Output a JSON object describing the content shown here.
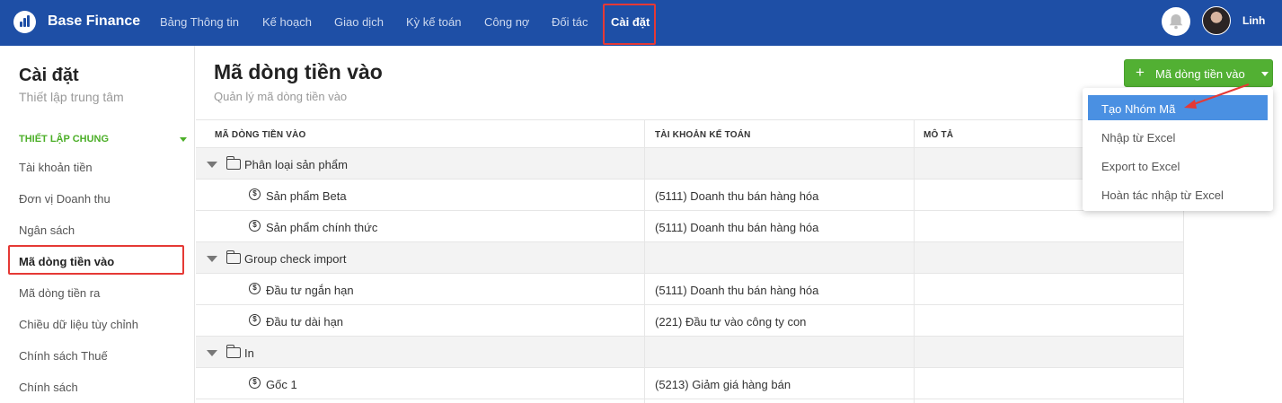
{
  "header": {
    "brand": "Base Finance",
    "nav": [
      {
        "label": "Bảng Thông tin"
      },
      {
        "label": "Kế hoạch"
      },
      {
        "label": "Giao dịch"
      },
      {
        "label": "Kỳ kế toán"
      },
      {
        "label": "Công nợ"
      },
      {
        "label": "Đối tác"
      },
      {
        "label": "Cài đặt",
        "active": true
      }
    ],
    "user_name": "Linh",
    "icons": [
      "bell-icon",
      "avatar"
    ]
  },
  "sidebar": {
    "title": "Cài đặt",
    "subtitle": "Thiết lập trung tâm",
    "section": "THIẾT LẬP CHUNG",
    "items": [
      {
        "label": "Tài khoản tiền"
      },
      {
        "label": "Đơn vị Doanh thu"
      },
      {
        "label": "Ngân sách"
      },
      {
        "label": "Mã dòng tiền vào",
        "active": true
      },
      {
        "label": "Mã dòng tiền ra"
      },
      {
        "label": "Chiều dữ liệu tùy chỉnh"
      },
      {
        "label": "Chính sách Thuế"
      },
      {
        "label": "Chính sách"
      }
    ]
  },
  "main": {
    "title": "Mã dòng tiền vào",
    "subtitle": "Quản lý mã dòng tiền vào",
    "primary_button": {
      "icon": "+",
      "label": "Mã dòng tiền vào"
    },
    "table": {
      "columns": [
        "MÃ DÒNG TIỀN VÀO",
        "TÀI KHOẢN KẾ TOÁN",
        "MÔ TẢ"
      ],
      "rows": [
        {
          "type": "group",
          "name": "Phân loại sản phẩm"
        },
        {
          "type": "item",
          "name": "Sản phẩm Beta",
          "account": "(5111) Doanh thu bán hàng hóa"
        },
        {
          "type": "item",
          "name": "Sản phẩm chính thức",
          "account": "(5111) Doanh thu bán hàng hóa"
        },
        {
          "type": "group",
          "name": "Group check import"
        },
        {
          "type": "item",
          "name": "Đầu tư ngắn hạn",
          "account": "(5111) Doanh thu bán hàng hóa"
        },
        {
          "type": "item",
          "name": "Đầu tư dài hạn",
          "account": "(221) Đầu tư vào công ty con"
        },
        {
          "type": "group",
          "name": "In"
        },
        {
          "type": "item",
          "name": "Gốc 1",
          "account": "(5213) Giảm giá hàng bán"
        }
      ]
    },
    "dropdown": {
      "items": [
        {
          "label": "Tạo Nhóm Mã",
          "active": true
        },
        {
          "label": "Nhập từ Excel"
        },
        {
          "label": "Export to Excel"
        },
        {
          "label": "Hoàn tác nhập từ Excel"
        }
      ]
    }
  },
  "colors": {
    "header_bg": "#1e4fa6",
    "accent_green": "#52b033",
    "highlight_red": "#e53935",
    "dropdown_active": "#4a90e2"
  }
}
